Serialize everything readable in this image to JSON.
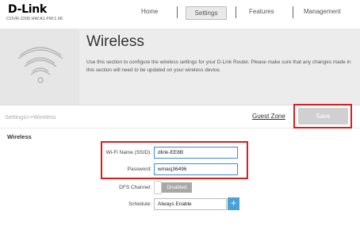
{
  "brand": {
    "logo": "D-Link",
    "model": "COVR-2200 HW:A1 FW:1.06"
  },
  "nav": {
    "home": "Home",
    "settings": "Settings",
    "features": "Features",
    "management": "Management",
    "active": "settings"
  },
  "banner": {
    "title": "Wireless",
    "description": "Use this section to configure the wireless settings for your D-Link Router. Please make sure that any changes made in this section will need to be updated on your wireless device."
  },
  "breadcrumb": "Settings>>Wireless",
  "actions": {
    "guest_zone": "Guest Zone",
    "save": "Save"
  },
  "form": {
    "section_title": "Wireless",
    "ssid": {
      "label": "Wi-Fi Name (SSID):",
      "value": "dlink-EE8B"
    },
    "password": {
      "label": "Password:",
      "value": "wmacj36496"
    },
    "dfs": {
      "label": "DFS Channel:",
      "state": "Disabled"
    },
    "schedule": {
      "label": "Schedule:",
      "value": "Always Enable",
      "add": "+"
    }
  },
  "colors": {
    "highlight": "#e01b1b",
    "accent": "#3a8dde",
    "plus_button": "#4aa1d6"
  }
}
